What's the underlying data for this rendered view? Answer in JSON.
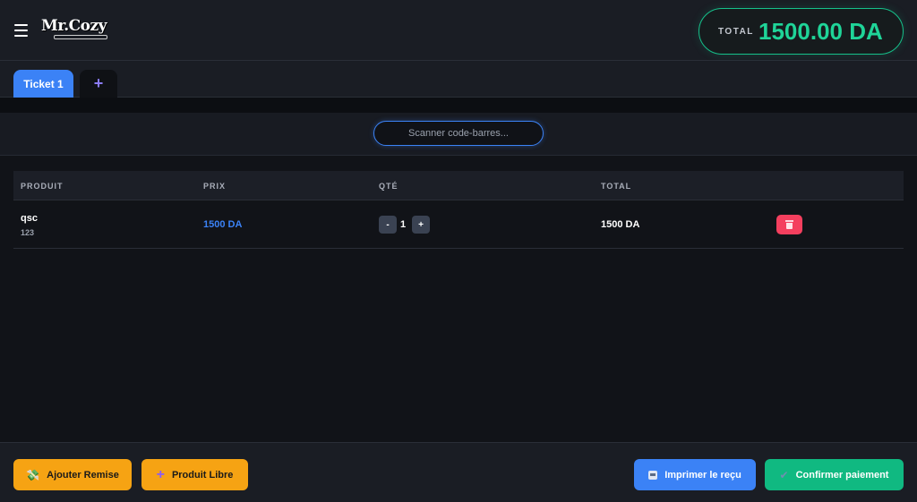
{
  "header": {
    "logo_text": "Mr.Cozy",
    "total_label": "TOTAL",
    "total_value": "1500.00 DA"
  },
  "tabs": [
    {
      "label": "Ticket 1",
      "active": true
    },
    {
      "label": "+",
      "active": false
    }
  ],
  "scanner": {
    "placeholder": "Scanner code-barres..."
  },
  "table": {
    "columns": [
      "PRODUIT",
      "PRIX",
      "QTÉ",
      "TOTAL"
    ],
    "rows": [
      {
        "name": "qsc",
        "code": "123",
        "price": "1500 DA",
        "qty": "1",
        "total": "1500 DA",
        "minus_label": "-",
        "plus_label": "+"
      }
    ]
  },
  "footer": {
    "discount_label": "Ajouter Remise",
    "free_product_label": "Produit Libre",
    "print_label": "Imprimer le reçu",
    "confirm_label": "Confirmer paiement"
  },
  "colors": {
    "accent_blue": "#3b82f6",
    "accent_green": "#1fd498",
    "warning_orange": "#f6a313",
    "danger_red": "#f43f5e",
    "background": "#111318"
  }
}
